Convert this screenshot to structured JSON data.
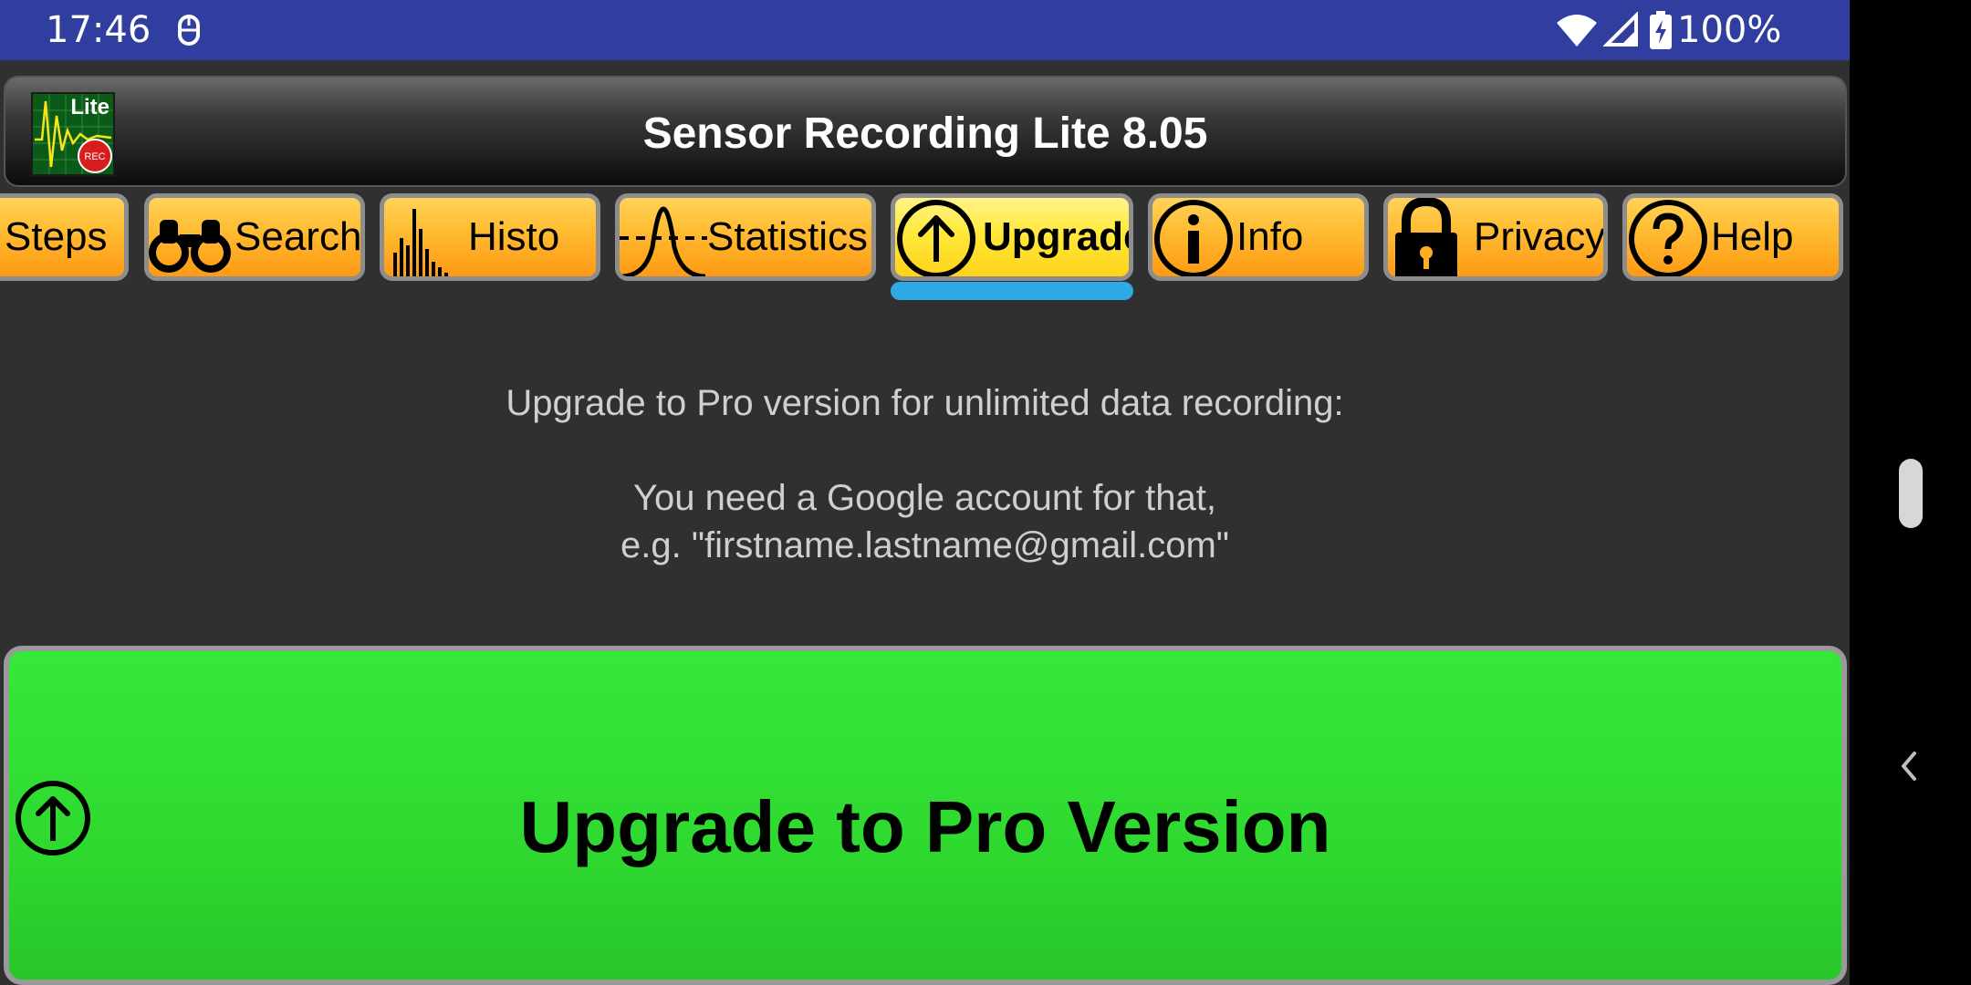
{
  "status_bar": {
    "time": "17:46",
    "battery_text": "100%",
    "icons": [
      "notification-icon",
      "wifi-icon",
      "signal-icon",
      "battery-charging-icon"
    ]
  },
  "app": {
    "title": "Sensor Recording Lite 8.05",
    "logo_text": "Lite",
    "logo_badge": "REC"
  },
  "tabs": [
    {
      "label": "Steps",
      "icon": "steps-icon",
      "active": false
    },
    {
      "label": "Search",
      "icon": "binoculars-icon",
      "active": false
    },
    {
      "label": "Histo",
      "icon": "histogram-icon",
      "active": false
    },
    {
      "label": "Statistics",
      "icon": "bell-curve-icon",
      "active": false
    },
    {
      "label": "Upgrade",
      "icon": "arrow-up-circle-icon",
      "active": true
    },
    {
      "label": "Info",
      "icon": "info-icon",
      "active": false
    },
    {
      "label": "Privacy",
      "icon": "lock-icon",
      "active": false
    },
    {
      "label": "Help",
      "icon": "help-icon",
      "active": false
    }
  ],
  "content": {
    "line1": "Upgrade to Pro version for unlimited data recording:",
    "line2": "You need a Google account for that,",
    "line3": "e.g. \"firstname.lastname@gmail.com\"",
    "upgrade_button_label": "Upgrade to Pro Version"
  },
  "colors": {
    "status_bar": "#303F9F",
    "background": "#303030",
    "tab": "#FFB020",
    "tab_active": "#FFE93A",
    "tab_indicator": "#2FA9E3",
    "upgrade_button": "#33E033"
  }
}
